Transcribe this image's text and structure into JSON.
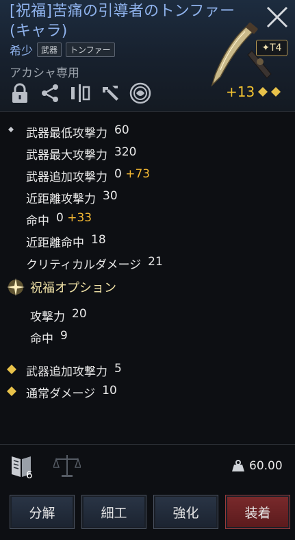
{
  "item": {
    "title": "[祝福]苦痛の引導者のトンファー(キャラ)",
    "rarity": "希少",
    "tags": [
      "武器",
      "トンファー"
    ],
    "exclusive": "アカシャ専用",
    "tier": "✦T4",
    "enhancement": "+13"
  },
  "base_stats": [
    {
      "label": "武器最低攻撃力",
      "value": "60",
      "bonus": ""
    },
    {
      "label": "武器最大攻撃力",
      "value": "320",
      "bonus": ""
    },
    {
      "label": "武器追加攻撃力",
      "value": "0",
      "bonus": "+73"
    },
    {
      "label": "近距離攻撃力",
      "value": "30",
      "bonus": ""
    },
    {
      "label": "命中",
      "value": "0",
      "bonus": "+33"
    },
    {
      "label": "近距離命中",
      "value": "18",
      "bonus": ""
    },
    {
      "label": "クリティカルダメージ",
      "value": "21",
      "bonus": ""
    }
  ],
  "blessing": {
    "title": "祝福オプション",
    "stats": [
      {
        "label": "攻撃力",
        "value": "20"
      },
      {
        "label": "命中",
        "value": "9"
      }
    ]
  },
  "extra_stats": [
    {
      "label": "武器追加攻撃力",
      "value": "5"
    },
    {
      "label": "通常ダメージ",
      "value": "10"
    }
  ],
  "footer": {
    "book_count": "6",
    "weight": "60.00"
  },
  "buttons": {
    "disassemble": "分解",
    "craft": "細工",
    "enhance": "強化",
    "equip": "装着"
  },
  "colors": {
    "title": "#8fb2ec",
    "bonus": "#f2b733",
    "enhance": "#f2c230",
    "equip_button": "#7a2a2c"
  }
}
